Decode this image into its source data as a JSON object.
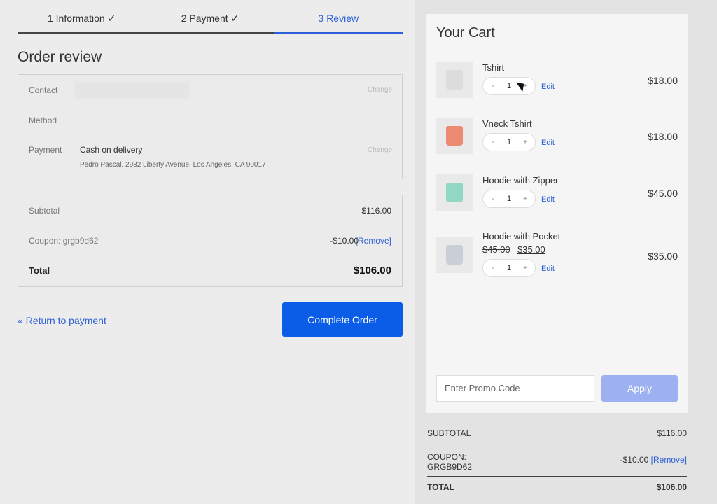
{
  "steps": {
    "info": "1 Information ✓",
    "payment": "2 Payment ✓",
    "review": "3 Review"
  },
  "page_title": "Order review",
  "review": {
    "contact_label": "Contact",
    "method_label": "Method",
    "payment_label": "Payment",
    "change": "Change",
    "payment_method": "Cash on delivery",
    "address": "Pedro Pascal, 2982 Liberty Avenue, Los Angeles, CA 90017"
  },
  "totals": {
    "subtotal_label": "Subtotal",
    "subtotal_value": "$116.00",
    "coupon_label": "Coupon: grgb9d62",
    "coupon_value": "-$10.00",
    "remove": "[Remove]",
    "total_label": "Total",
    "total_value": "$106.00"
  },
  "actions": {
    "return": "« Return to payment",
    "complete": "Complete Order"
  },
  "cart": {
    "title": "Your Cart",
    "items": [
      {
        "name": "Tshirt",
        "qty": "1",
        "price": "$18.00",
        "edit": "Edit",
        "color": "#dcdcdc"
      },
      {
        "name": "Vneck Tshirt",
        "qty": "1",
        "price": "$18.00",
        "edit": "Edit",
        "color": "#ee8a72"
      },
      {
        "name": "Hoodie with Zipper",
        "qty": "1",
        "price": "$45.00",
        "edit": "Edit",
        "color": "#91d7c3"
      },
      {
        "name": "Hoodie with Pocket",
        "qty": "1",
        "price": "$35.00",
        "old_price": "$45.00",
        "sale_price": "$35.00",
        "edit": "Edit",
        "color": "#c9ced7"
      }
    ],
    "promo_placeholder": "Enter Promo Code",
    "apply": "Apply"
  },
  "summary": {
    "subtotal_label": "SUBTOTAL",
    "subtotal_value": "$116.00",
    "coupon_label_1": "COUPON:",
    "coupon_label_2": "GRGB9D62",
    "coupon_value": "-$10.00",
    "remove": "[Remove]",
    "total_label": "TOTAL",
    "total_value": "$106.00"
  }
}
